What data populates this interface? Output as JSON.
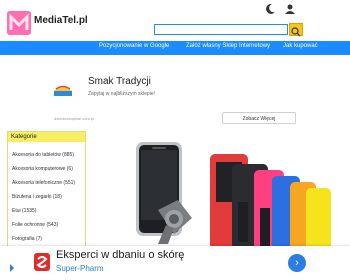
{
  "header": {
    "logo_text": "MediaTel.pl",
    "search": {
      "placeholder": "",
      "value": ""
    }
  },
  "nav": {
    "items": [
      {
        "label": "Pozycjonowanie w Google"
      },
      {
        "label": "Załóż własny Sklep Internetowy"
      },
      {
        "label": "Jak kupować"
      }
    ]
  },
  "top_ad": {
    "title": "Smak Tradycji",
    "subtitle": "Zapytaj w najbliższym sklepie!",
    "url": "dziecieceopisie.com.pl",
    "button_label": "Zobacz Więcej"
  },
  "sidebar": {
    "heading": "Kategorie",
    "items": [
      {
        "label": "Akcesoria do tabletów (885)"
      },
      {
        "label": "Akcesoria komputerowe (6)"
      },
      {
        "label": "Akcesoria telefoniczne (551)"
      },
      {
        "label": "Biżuteria i zegarki (18)"
      },
      {
        "label": "Etui (1535)"
      },
      {
        "label": "Folie ochronne (543)"
      },
      {
        "label": "Fotografia (7)"
      }
    ]
  },
  "bottom_ad": {
    "title": "Eksperci w dbaniu o skórę",
    "subtitle": "Super-Pharm"
  },
  "colors": {
    "nav": "#1a8cff",
    "search_button": "#f5c518",
    "sidebar_header": "#f7ef62",
    "logo": "#ff6fb0",
    "ad_brand": "#e22b2b",
    "link": "#2a7de1"
  },
  "icons": [
    "theme-toggle-icon",
    "user-icon",
    "search-icon",
    "chevron-right-icon"
  ]
}
